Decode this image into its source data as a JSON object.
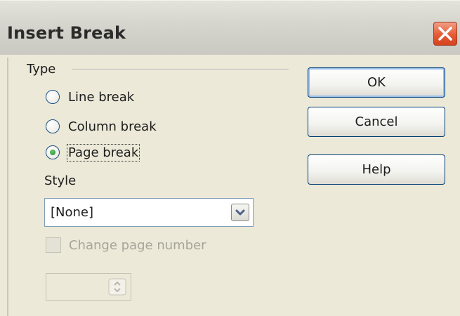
{
  "window": {
    "title": "Insert Break"
  },
  "type_group": {
    "label": "Type",
    "options": [
      {
        "label": "Line break",
        "selected": false
      },
      {
        "label": "Column break",
        "selected": false
      },
      {
        "label": "Page break",
        "selected": true
      }
    ]
  },
  "style": {
    "label": "Style",
    "value": "[None]"
  },
  "change_page_number": {
    "label": "Change page number",
    "enabled": false,
    "checked": false
  },
  "page_number_spin": {
    "value": ""
  },
  "buttons": {
    "ok": "OK",
    "cancel": "Cancel",
    "help": "Help"
  },
  "icons": {
    "close": "close-icon",
    "dropdown": "chevron-down-icon",
    "spin": "spin-arrows-icon",
    "radio": "radio-icon",
    "checkbox": "checkbox-icon"
  },
  "colors": {
    "title_bar": "#d6d6cf",
    "dialog_bg": "#ece9d8",
    "close_button": "#e55b36",
    "focus_border": "#003c74"
  }
}
